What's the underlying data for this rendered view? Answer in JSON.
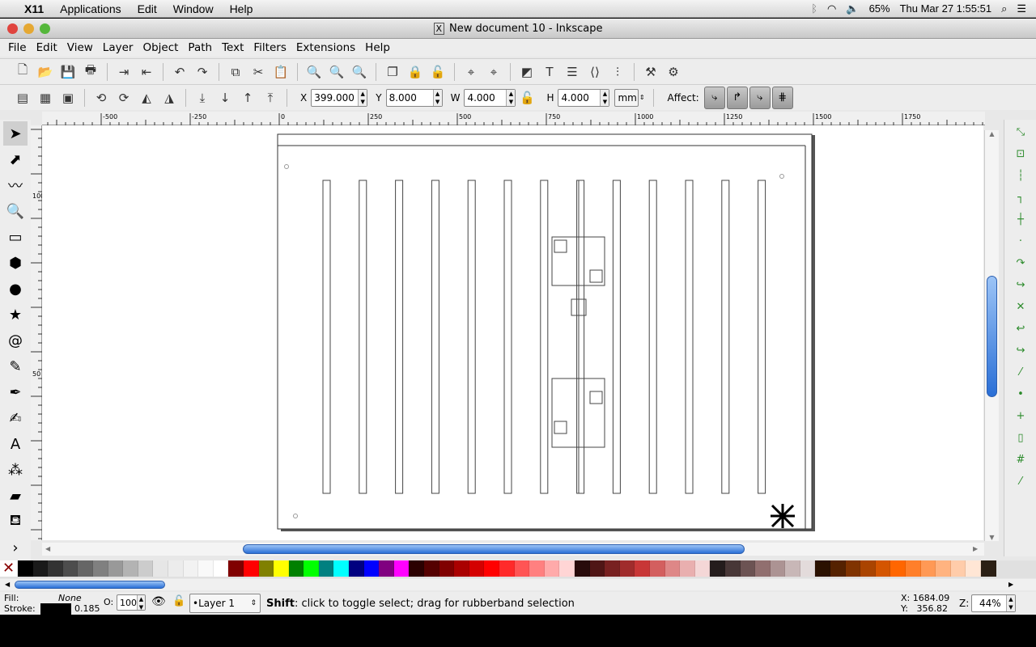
{
  "mac_menubar": {
    "apple": "",
    "app": "X11",
    "items": [
      "Applications",
      "Edit",
      "Window",
      "Help"
    ],
    "battery": "65%",
    "clock": "Thu Mar 27  1:55:51"
  },
  "window": {
    "title": "New document 10 - Inkscape"
  },
  "menu": [
    "File",
    "Edit",
    "View",
    "Layer",
    "Object",
    "Path",
    "Text",
    "Filters",
    "Extensions",
    "Help"
  ],
  "commands_bar": [
    {
      "name": "new-icon",
      "g": "🗋"
    },
    {
      "name": "open-icon",
      "g": "📂"
    },
    {
      "name": "save-icon",
      "g": "💾"
    },
    {
      "name": "print-icon",
      "g": "🖶"
    },
    {
      "sep": true
    },
    {
      "name": "import-icon",
      "g": "⇥"
    },
    {
      "name": "export-icon",
      "g": "⇤"
    },
    {
      "sep": true
    },
    {
      "name": "undo-icon",
      "g": "↶"
    },
    {
      "name": "redo-icon",
      "g": "↷"
    },
    {
      "sep": true
    },
    {
      "name": "duplicate-icon",
      "g": "⧉"
    },
    {
      "name": "cut-icon",
      "g": "✂"
    },
    {
      "name": "paste-icon",
      "g": "📋"
    },
    {
      "sep": true
    },
    {
      "name": "zoom-selection-icon",
      "g": "🔍"
    },
    {
      "name": "zoom-drawing-icon",
      "g": "🔍"
    },
    {
      "name": "zoom-page-icon",
      "g": "🔍"
    },
    {
      "sep": true
    },
    {
      "name": "group-icon",
      "g": "❐"
    },
    {
      "name": "lock-group-icon",
      "g": "🔒"
    },
    {
      "name": "unlock-group-icon",
      "g": "🔓"
    },
    {
      "sep": true
    },
    {
      "name": "snap-to-icon",
      "g": "⌖"
    },
    {
      "name": "snap-icon",
      "g": "⌖"
    },
    {
      "sep": true
    },
    {
      "name": "fill-stroke-icon",
      "g": "◩"
    },
    {
      "name": "text-icon",
      "g": "T"
    },
    {
      "name": "layers-icon",
      "g": "☰"
    },
    {
      "name": "xml-editor-icon",
      "g": "⟨⟩"
    },
    {
      "name": "align-icon",
      "g": "⫶"
    },
    {
      "sep": true
    },
    {
      "name": "preferences-icon",
      "g": "⚒"
    },
    {
      "name": "document-properties-icon",
      "g": "⚙"
    }
  ],
  "select_bar": {
    "icons": [
      {
        "name": "select-all-icon",
        "g": "▤"
      },
      {
        "name": "select-all-layers-icon",
        "g": "▦"
      },
      {
        "name": "deselect-icon",
        "g": "▣"
      },
      {
        "sep": true
      },
      {
        "name": "rotate-ccw-icon",
        "g": "⟲"
      },
      {
        "name": "rotate-cw-icon",
        "g": "⟳"
      },
      {
        "name": "flip-horizontal-icon",
        "g": "◭"
      },
      {
        "name": "flip-vertical-icon",
        "g": "◮"
      },
      {
        "sep": true
      },
      {
        "name": "lower-bottom-icon",
        "g": "⤓"
      },
      {
        "name": "lower-icon",
        "g": "↓"
      },
      {
        "name": "raise-icon",
        "g": "↑"
      },
      {
        "name": "raise-top-icon",
        "g": "⤒"
      }
    ],
    "x_label": "X",
    "x": "399.000",
    "y_label": "Y",
    "y": "8.000",
    "w_label": "W",
    "w": "4.000",
    "h_label": "H",
    "h": "4.000",
    "unit": "mm",
    "affect_label": "Affect:"
  },
  "ruler": {
    "h_ticks": [
      "-500",
      "-250",
      "0",
      "250",
      "500",
      "750",
      "1000",
      "1250",
      "1500",
      "1750"
    ],
    "v_ticks": [
      "100",
      "50",
      "0"
    ]
  },
  "tools": [
    {
      "name": "selector-tool-icon",
      "g": "➤"
    },
    {
      "name": "node-tool-icon",
      "g": "⬈"
    },
    {
      "name": "tweak-tool-icon",
      "g": "〰"
    },
    {
      "name": "zoom-tool-icon",
      "g": "🔍"
    },
    {
      "name": "rectangle-tool-icon",
      "g": "▭"
    },
    {
      "name": "3d-box-tool-icon",
      "g": "⬢"
    },
    {
      "name": "ellipse-tool-icon",
      "g": "●"
    },
    {
      "name": "star-tool-icon",
      "g": "★"
    },
    {
      "name": "spiral-tool-icon",
      "g": "@"
    },
    {
      "name": "pencil-tool-icon",
      "g": "✎"
    },
    {
      "name": "pen-tool-icon",
      "g": "✒"
    },
    {
      "name": "calligraphy-tool-icon",
      "g": "✍"
    },
    {
      "name": "text-tool-icon",
      "g": "A"
    },
    {
      "name": "spray-tool-icon",
      "g": "⁂"
    },
    {
      "name": "eraser-tool-icon",
      "g": "▰"
    },
    {
      "name": "paint-bucket-tool-icon",
      "g": "⛾"
    },
    {
      "name": "expand-icon",
      "g": "›"
    }
  ],
  "snap_tools": [
    {
      "name": "snap-enable-icon",
      "g": "⤡"
    },
    {
      "name": "snap-bbox-icon",
      "g": "⊡"
    },
    {
      "name": "snap-bbox-edge-icon",
      "g": "┆"
    },
    {
      "name": "snap-bbox-corner-icon",
      "g": "┐"
    },
    {
      "name": "snap-bbox-mid-icon",
      "g": "┼"
    },
    {
      "name": "snap-bbox-center-icon",
      "g": "·"
    },
    {
      "name": "snap-nodes-icon",
      "g": "↷"
    },
    {
      "name": "snap-paths-icon",
      "g": "↪"
    },
    {
      "name": "snap-intersection-icon",
      "g": "✕"
    },
    {
      "name": "snap-cusp-icon",
      "g": "↩"
    },
    {
      "name": "snap-smooth-icon",
      "g": "↪"
    },
    {
      "name": "snap-midpoint-icon",
      "g": "⁄"
    },
    {
      "name": "snap-center-icon",
      "g": "•"
    },
    {
      "name": "snap-rotation-icon",
      "g": "+"
    },
    {
      "name": "snap-page-icon",
      "g": "▯"
    },
    {
      "name": "snap-grid-icon",
      "g": "#"
    },
    {
      "name": "snap-guide-icon",
      "g": "⁄"
    }
  ],
  "palette": [
    "#000000",
    "#1a1a1a",
    "#333333",
    "#4d4d4d",
    "#666666",
    "#808080",
    "#999999",
    "#b3b3b3",
    "#cccccc",
    "#e6e6e6",
    "#ececec",
    "#f2f2f2",
    "#f9f9f9",
    "#ffffff",
    "#800000",
    "#ff0000",
    "#808000",
    "#ffff00",
    "#008000",
    "#00ff00",
    "#008080",
    "#00ffff",
    "#000080",
    "#0000ff",
    "#800080",
    "#ff00ff",
    "#2b0000",
    "#550000",
    "#800000",
    "#aa0000",
    "#d40000",
    "#ff0000",
    "#ff2a2a",
    "#ff5555",
    "#ff8080",
    "#ffaaaa",
    "#ffd5d5",
    "#280b0b",
    "#501616",
    "#782121",
    "#a02c2c",
    "#c83737",
    "#d35f5f",
    "#de8787",
    "#e9afaf",
    "#f4d7d7",
    "#241c1c",
    "#483737",
    "#6c5353",
    "#916f6f",
    "#ac9393",
    "#c8b7b7",
    "#e3dbdb",
    "#2b1100",
    "#552200",
    "#803300",
    "#aa4400",
    "#d45500",
    "#ff6600",
    "#ff7f2a",
    "#ff9955",
    "#ffb380",
    "#ffccaa",
    "#ffe6d5",
    "#2b1f14"
  ],
  "status": {
    "fill_label": "Fill:",
    "fill_value": "None",
    "stroke_label": "Stroke:",
    "stroke_width": "0.185",
    "opacity_label": "O:",
    "opacity": "100",
    "layer": "•Layer 1",
    "message_bold": "Shift",
    "message": ": click to toggle select; drag for rubberband selection",
    "cursor_x": "X: 1684.09",
    "cursor_y": "Y:   356.82",
    "zoom_label": "Z:",
    "zoom": "44%"
  }
}
